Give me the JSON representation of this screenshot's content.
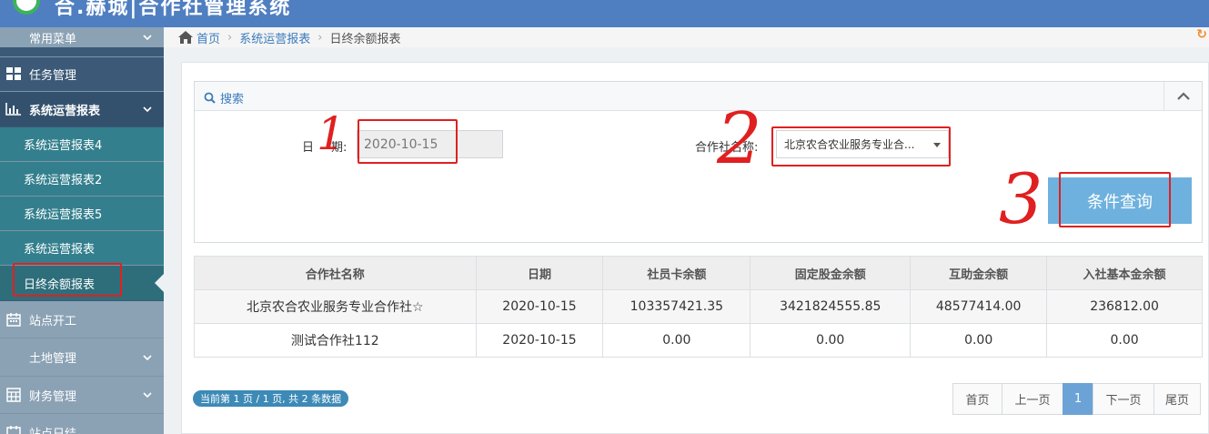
{
  "header": {
    "title": "合.赫城|合作社管理系统"
  },
  "sidebar": {
    "items": [
      {
        "label": "常用菜单",
        "icon": "none"
      },
      {
        "label": "任务管理",
        "icon": "dashboard-icon"
      },
      {
        "label": "系统运营报表",
        "icon": "bar-chart-icon"
      },
      {
        "label": "系统运营报表4"
      },
      {
        "label": "系统运营报表2"
      },
      {
        "label": "系统运营报表5"
      },
      {
        "label": "系统运营报表"
      },
      {
        "label": "日终余额报表"
      },
      {
        "label": "站点开工",
        "icon": "calendar-icon"
      },
      {
        "label": "土地管理",
        "icon": "none"
      },
      {
        "label": "财务管理",
        "icon": "calculator-icon"
      },
      {
        "label": "站点日结",
        "icon": "calendar-icon"
      }
    ]
  },
  "breadcrumb": {
    "home": "首页",
    "parent": "系统运营报表",
    "current": "日终余额报表"
  },
  "search": {
    "title": "搜索",
    "date_label_a": "日",
    "date_label_b": "期:",
    "date_value": "2020-10-15",
    "coop_label": "合作社名称:",
    "coop_value": "北京农合农业服务专业合...",
    "query_button": "条件查询"
  },
  "table": {
    "columns": [
      "合作社名称",
      "日期",
      "社员卡余额",
      "固定股金余额",
      "互助金余额",
      "入社基本金余额"
    ],
    "rows": [
      [
        "北京农合农业服务专业合作社☆",
        "2020-10-15",
        "103357421.35",
        "3421824555.85",
        "48577414.00",
        "236812.00"
      ],
      [
        "测试合作社112",
        "2020-10-15",
        "0.00",
        "0.00",
        "0.00",
        "0.00"
      ]
    ]
  },
  "pagination": {
    "info": "当前第 1 页 / 1 页, 共 2 条数据",
    "first": "首页",
    "prev": "上一页",
    "current": "1",
    "next": "下一页",
    "last": "尾页"
  },
  "annotations": {
    "n1": "1",
    "n2": "2",
    "n3": "3"
  },
  "colors": {
    "header": "#4f7fc1",
    "sidebar": "#3a5a78",
    "submenu": "#337f8d",
    "accent": "#3b7bbd",
    "query_button": "#6fb1de",
    "annotation": "#e02020"
  }
}
